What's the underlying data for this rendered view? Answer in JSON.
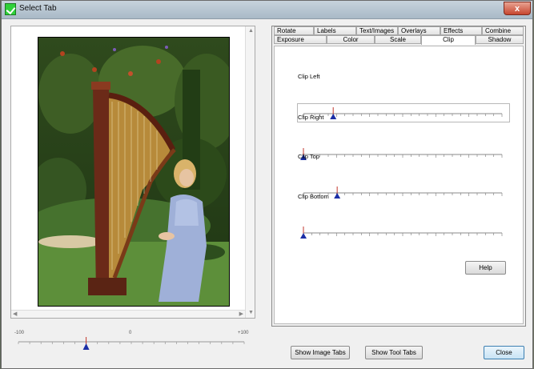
{
  "window": {
    "title": "Select Tab",
    "close_glyph": "x"
  },
  "tabs_row1": [
    "Rotate",
    "Labels",
    "Text/Images",
    "Overlays",
    "Effects",
    "Combine"
  ],
  "tabs_row2": [
    "Exposure",
    "Color",
    "Scale",
    "Clip",
    "Shadow"
  ],
  "selected_tab": "Clip",
  "clip": {
    "sliders": [
      {
        "label": "Clip Left",
        "position": 0.15
      },
      {
        "label": "Clip Right",
        "position": 0.0
      },
      {
        "label": "Clip Top",
        "position": 0.17
      },
      {
        "label": "Clip Bottom",
        "position": 0.0
      }
    ],
    "help_label": "Help"
  },
  "bottom_slider": {
    "min_label": "-100",
    "mid_label": "0",
    "max_label": "+100",
    "value": -40
  },
  "buttons": {
    "show_image_tabs": "Show Image Tabs",
    "show_tool_tabs": "Show Tool Tabs",
    "close": "Close"
  },
  "colors": {
    "thumb": "#1c2fa6",
    "thumb_line": "#c2352b",
    "accent": "#3c7fb1"
  },
  "icons": [
    "app-check-icon",
    "close-icon",
    "scroll-up-arrow-icon",
    "scroll-down-arrow-icon",
    "scroll-left-arrow-icon",
    "scroll-right-arrow-icon"
  ]
}
